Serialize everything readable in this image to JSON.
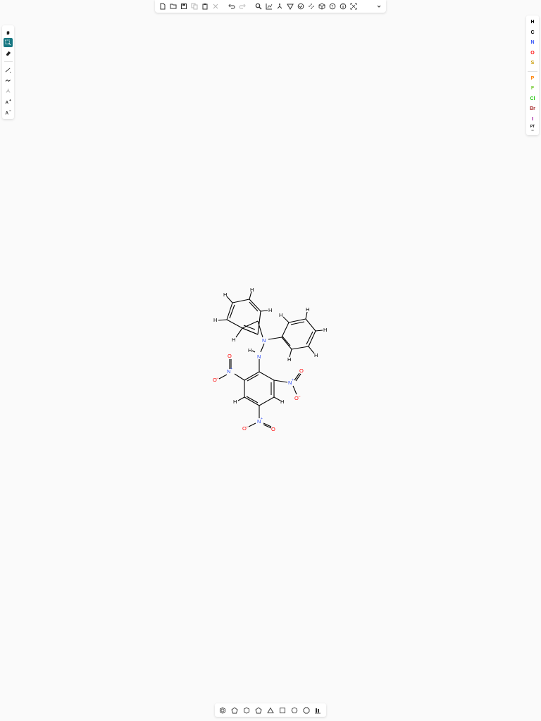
{
  "colors": {
    "accent": "#167782",
    "nitrogen": "#304ff7",
    "oxygen": "#ff0d0d",
    "sulfur": "#c99a00",
    "phosphorus": "#ff8000",
    "fluorine": "#78cc38",
    "chlorine": "#1fc70a",
    "bromine": "#a62929",
    "iodine": "#940094",
    "carbon": "#000000"
  },
  "top_toolbar": {
    "buttons": [
      "new-file-icon",
      "open-file-icon",
      "save-icon",
      "copy-icon",
      "paste-icon",
      "cut-icon",
      "undo-icon",
      "redo-icon",
      "zoom-icon",
      "layout-icon",
      "clean-icon",
      "aromatize-icon",
      "check-icon",
      "calculate-icon",
      "3d-view-icon",
      "info-icon",
      "help-icon",
      "fullscreen-icon",
      "chevron-down-icon"
    ]
  },
  "left_toolbar": {
    "tools": [
      "hand-icon",
      "select-icon",
      "eraser-icon",
      "bond-icon",
      "chain-icon",
      "stereo-icon",
      "charge-plus-icon",
      "charge-minus-icon"
    ]
  },
  "atom_palette": {
    "atoms": [
      {
        "symbol": "H",
        "color": "#000000"
      },
      {
        "symbol": "C",
        "color": "#000000"
      },
      {
        "symbol": "N",
        "color": "#304ff7"
      },
      {
        "symbol": "O",
        "color": "#ff0d0d"
      },
      {
        "symbol": "S",
        "color": "#c99a00"
      }
    ],
    "halogens": [
      {
        "symbol": "P",
        "color": "#ff8000"
      },
      {
        "symbol": "F",
        "color": "#78cc38"
      },
      {
        "symbol": "Cl",
        "color": "#1fc70a"
      },
      {
        "symbol": "Br",
        "color": "#a62929"
      },
      {
        "symbol": "I",
        "color": "#940094"
      }
    ],
    "periodic_table": {
      "line1": "PT",
      "line2": "▪▪▪"
    }
  },
  "bottom_toolbar": {
    "shapes": [
      "benzene-icon",
      "cyclopentadiene-icon",
      "cyclohexane-icon",
      "cyclopentane-icon",
      "cyclopropane-icon",
      "cyclobutane-icon",
      "cycloheptane-icon",
      "cyclooctane-icon",
      "template-library-icon"
    ]
  },
  "molecule": {
    "atom_labels": {
      "H": "H",
      "N": "N",
      "N_plus": "N",
      "plus": "+",
      "O": "O",
      "O_minus": "O",
      "minus": "−"
    }
  }
}
